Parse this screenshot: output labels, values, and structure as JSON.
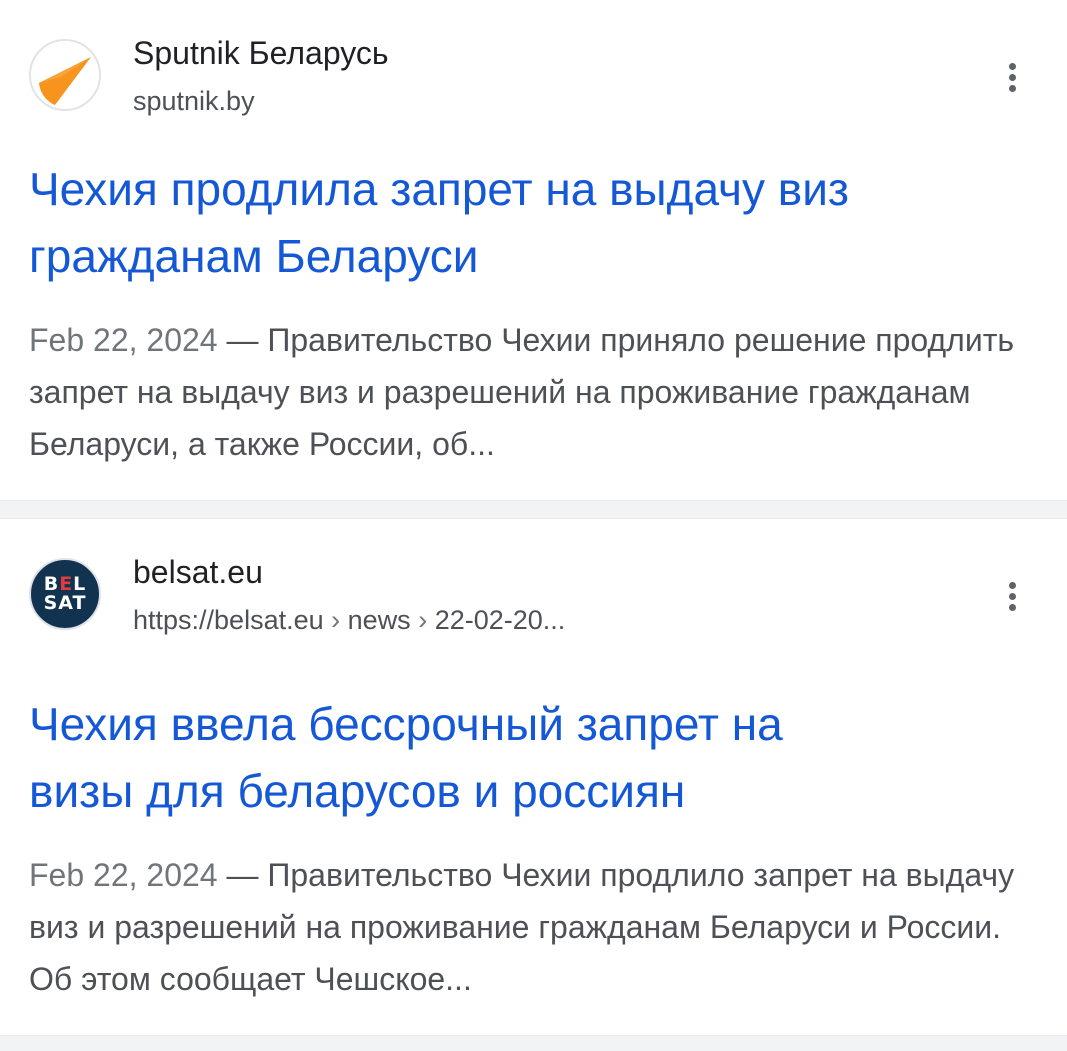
{
  "results": [
    {
      "source_name": "Sputnik Беларусь",
      "source_url": "sputnik.by",
      "favicon": "sputnik-logo-icon",
      "title_line1": "Чехия продлила запрет на выдачу виз",
      "title_line2": "гражданам Беларуси",
      "date": "Feb 22, 2024",
      "dash": "—",
      "snippet": "Правительство Чехии приняло решение продлить запрет на выдачу виз и разрешений на проживание гражданам Беларуси, а также России, об..."
    },
    {
      "source_name": "belsat.eu",
      "url_base": "https://belsat.eu",
      "breadcrumb_sep": "›",
      "url_crumb1": "news",
      "url_crumb2": "22-02-20...",
      "favicon_line1_b": "B",
      "favicon_line1_e": "E",
      "favicon_line1_l": "L",
      "favicon_line2": "SAT",
      "title_line1": "Чехия ввела бессрочный запрет на",
      "title_line2": "визы для беларусов и россиян",
      "date": "Feb 22, 2024",
      "dash": "—",
      "snippet": "Правительство Чехии продлило запрет на выдачу виз и разрешений на проживание гражданам Беларуси и России. Об этом сообщает Чешское..."
    }
  ],
  "icons": {
    "more": "more-vert-icon"
  },
  "colors": {
    "title_link": "#1558d6",
    "snippet_text": "#4d5156",
    "divider": "#f1f3f4",
    "sputnik_orange": "#f7941d",
    "belsat_navy": "#113350",
    "belsat_red": "#e33b3b"
  }
}
